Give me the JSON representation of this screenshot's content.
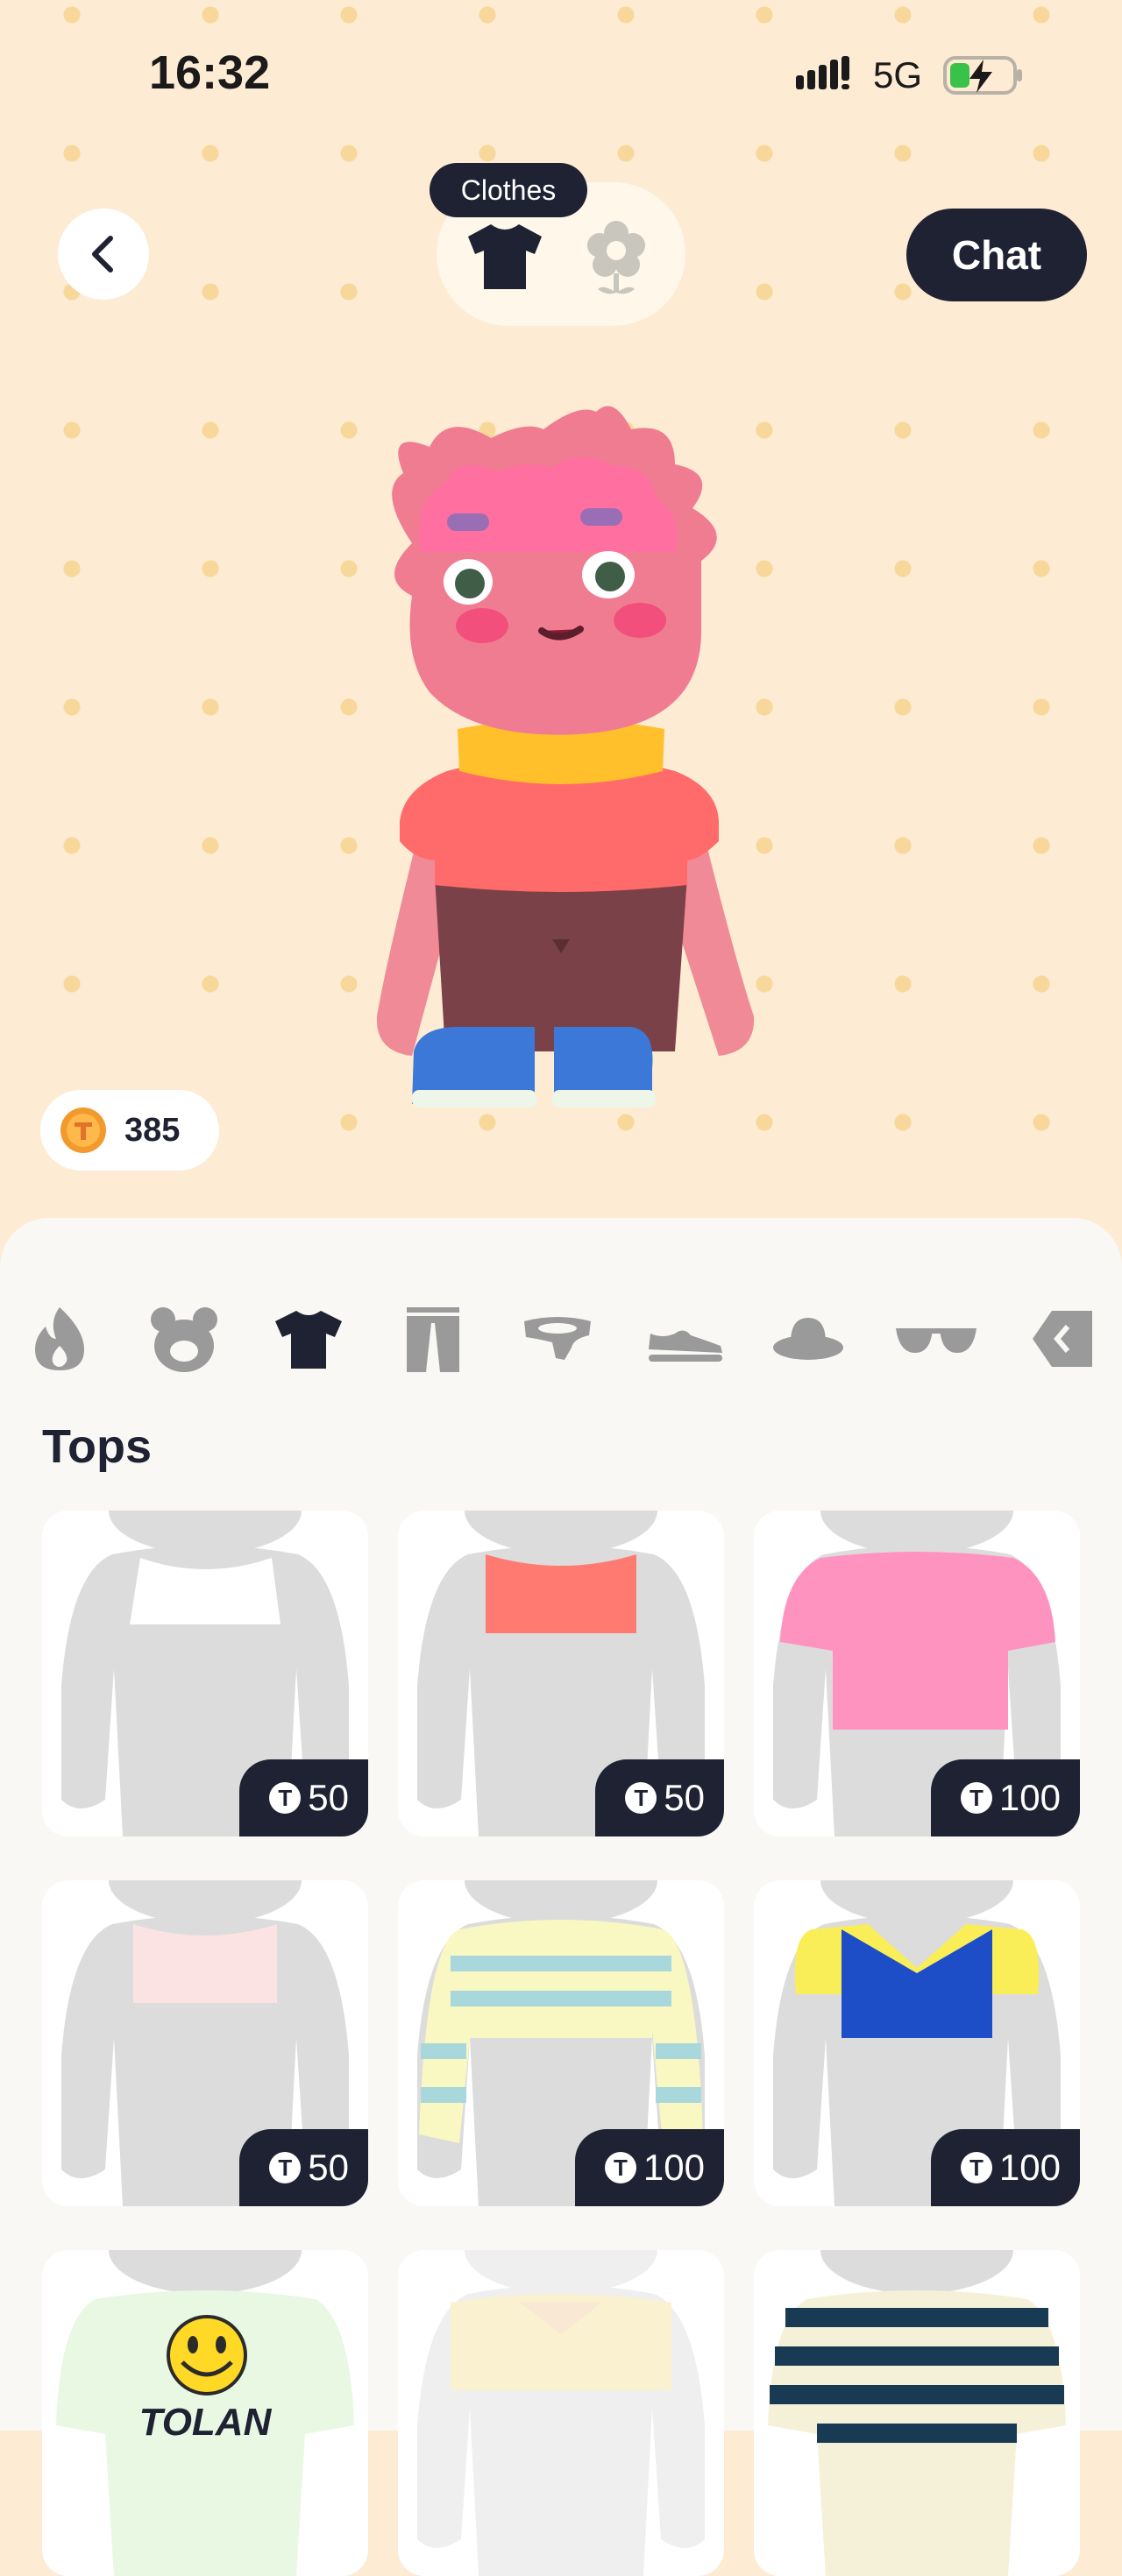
{
  "status_bar": {
    "time": "16:32",
    "network": "5G"
  },
  "header": {
    "tooltip": "Clothes",
    "chat_label": "Chat"
  },
  "coins": {
    "balance": "385"
  },
  "section": {
    "title": "Tops"
  },
  "categories": [
    "fire-icon",
    "bear-ears-icon",
    "shirt-icon",
    "pants-icon",
    "neckwear-icon",
    "shoe-icon",
    "hat-icon",
    "sunglasses-icon",
    "tag-icon"
  ],
  "items": [
    {
      "price": "50",
      "color": "#ffffff"
    },
    {
      "price": "50",
      "color": "#ff7b72"
    },
    {
      "price": "100",
      "color": "#ff93c0"
    },
    {
      "price": "50",
      "color": "#fbe3e3"
    },
    {
      "price": "100",
      "color": "#f9f7c2"
    },
    {
      "price": "100",
      "color": "#1d4ec7"
    },
    {
      "price": "",
      "color": "#e8f8e3",
      "print": "TOLAN"
    },
    {
      "price": "",
      "color": "#f6f0d8"
    },
    {
      "price": "",
      "color": "#183a52"
    }
  ],
  "colors": {
    "dark": "#1f2233",
    "background": "#fdebd3",
    "dots": "#f7d79a"
  }
}
